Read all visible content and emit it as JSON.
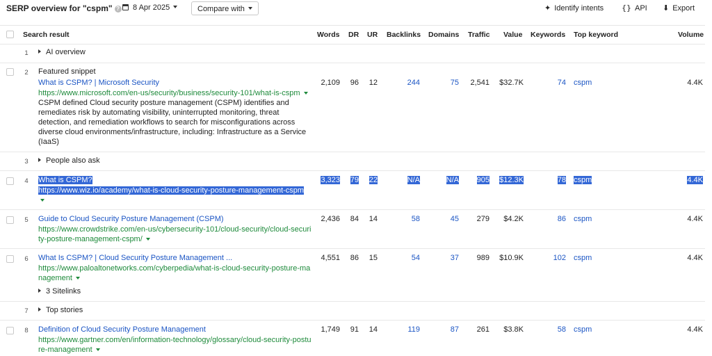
{
  "toolbar": {
    "title": "SERP overview for \"cspm\"",
    "help_glyph": "?",
    "date": "8 Apr 2025",
    "compare": "Compare with",
    "identify": "Identify intents",
    "api": "API",
    "export": "Export"
  },
  "columns": {
    "result": "Search result",
    "words": "Words",
    "dr": "DR",
    "ur": "UR",
    "backlinks": "Backlinks",
    "domains": "Domains",
    "traffic": "Traffic",
    "value": "Value",
    "keywords": "Keywords",
    "top_keyword": "Top keyword",
    "volume": "Volume"
  },
  "rows": [
    {
      "num": "1",
      "label": "AI overview"
    },
    {
      "num": "2",
      "feature": "Featured snippet",
      "title": "What is CSPM? | Microsoft Security",
      "url": "https://www.microsoft.com/en-us/security/business/security-101/what-is-cspm",
      "snippet": "CSPM defined Cloud security posture management (CSPM) identifies and remediates risk by automating visibility, uninterrupted monitoring, threat detection, and remediation workflows to search for misconfigurations across diverse cloud environments/infrastructure, including: Infrastructure as a Service (IaaS)",
      "words": "2,109",
      "dr": "96",
      "ur": "12",
      "backlinks": "244",
      "domains": "75",
      "traffic": "2,541",
      "value": "$32.7K",
      "keywords": "74",
      "top_keyword": "cspm",
      "volume": "4.4K"
    },
    {
      "num": "3",
      "label": "People also ask"
    },
    {
      "num": "4",
      "title": "What is CSPM?",
      "url": "https://www.wiz.io/academy/what-is-cloud-security-posture-management-cspm",
      "words": "3,323",
      "dr": "79",
      "ur": "22",
      "backlinks": "N/A",
      "domains": "N/A",
      "traffic": "905",
      "value": "$12.3K",
      "keywords": "78",
      "top_keyword": "cspm",
      "volume": "4.4K"
    },
    {
      "num": "5",
      "title": "Guide to Cloud Security Posture Management (CSPM)",
      "url": "https://www.crowdstrike.com/en-us/cybersecurity-101/cloud-security/cloud-security-posture-management-cspm/",
      "words": "2,436",
      "dr": "84",
      "ur": "14",
      "backlinks": "58",
      "domains": "45",
      "traffic": "279",
      "value": "$4.2K",
      "keywords": "86",
      "top_keyword": "cspm",
      "volume": "4.4K"
    },
    {
      "num": "6",
      "title": "What Is CSPM? | Cloud Security Posture Management ...",
      "url": "https://www.paloaltonetworks.com/cyberpedia/what-is-cloud-security-posture-management",
      "sitelinks": "3 Sitelinks",
      "words": "4,551",
      "dr": "86",
      "ur": "15",
      "backlinks": "54",
      "domains": "37",
      "traffic": "989",
      "value": "$10.9K",
      "keywords": "102",
      "top_keyword": "cspm",
      "volume": "4.4K"
    },
    {
      "num": "7",
      "label": "Top stories"
    },
    {
      "num": "8",
      "title": "Definition of Cloud Security Posture Management",
      "url": "https://www.gartner.com/en/information-technology/glossary/cloud-security-posture-management",
      "words": "1,749",
      "dr": "91",
      "ur": "14",
      "backlinks": "119",
      "domains": "87",
      "traffic": "261",
      "value": "$3.8K",
      "keywords": "58",
      "top_keyword": "cspm",
      "volume": "4.4K"
    }
  ]
}
